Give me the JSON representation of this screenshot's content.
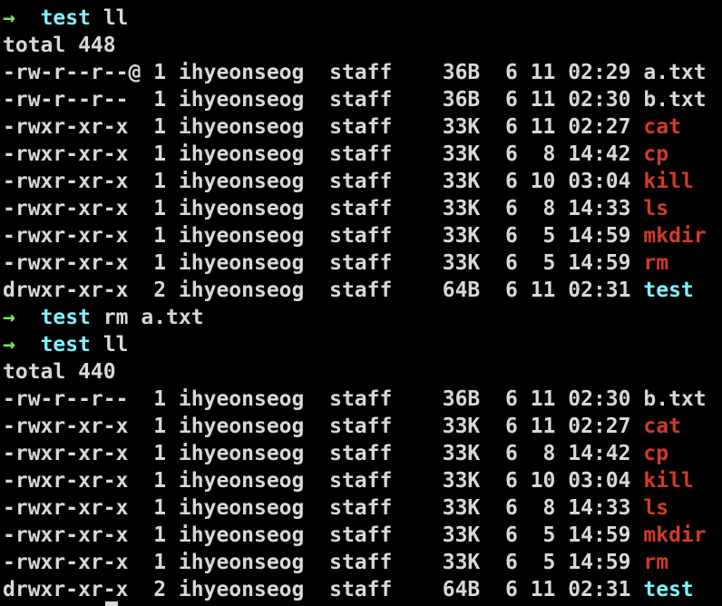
{
  "colors": {
    "background": "#000000",
    "text": "#d8d8d8",
    "prompt_arrow": "#7ee65e",
    "directory": "#7ef2ff",
    "executable": "#d13a26"
  },
  "prompt_symbol": "→",
  "lines": [
    {
      "kind": "prompt",
      "dir": "test",
      "cmd": "ll"
    },
    {
      "kind": "text",
      "text": "total 448"
    },
    {
      "kind": "entry",
      "perms": "-rw-r--r--@",
      "links": "1",
      "owner": "ihyeonseog",
      "group": "staff",
      "size": "36B",
      "month": "6",
      "day": "11",
      "time": "02:29",
      "name": "a.txt",
      "type": "file"
    },
    {
      "kind": "entry",
      "perms": "-rw-r--r--",
      "links": "1",
      "owner": "ihyeonseog",
      "group": "staff",
      "size": "36B",
      "month": "6",
      "day": "11",
      "time": "02:30",
      "name": "b.txt",
      "type": "file"
    },
    {
      "kind": "entry",
      "perms": "-rwxr-xr-x",
      "links": "1",
      "owner": "ihyeonseog",
      "group": "staff",
      "size": "33K",
      "month": "6",
      "day": "11",
      "time": "02:27",
      "name": "cat",
      "type": "exec"
    },
    {
      "kind": "entry",
      "perms": "-rwxr-xr-x",
      "links": "1",
      "owner": "ihyeonseog",
      "group": "staff",
      "size": "33K",
      "month": "6",
      "day": "8",
      "time": "14:42",
      "name": "cp",
      "type": "exec"
    },
    {
      "kind": "entry",
      "perms": "-rwxr-xr-x",
      "links": "1",
      "owner": "ihyeonseog",
      "group": "staff",
      "size": "33K",
      "month": "6",
      "day": "10",
      "time": "03:04",
      "name": "kill",
      "type": "exec"
    },
    {
      "kind": "entry",
      "perms": "-rwxr-xr-x",
      "links": "1",
      "owner": "ihyeonseog",
      "group": "staff",
      "size": "33K",
      "month": "6",
      "day": "8",
      "time": "14:33",
      "name": "ls",
      "type": "exec"
    },
    {
      "kind": "entry",
      "perms": "-rwxr-xr-x",
      "links": "1",
      "owner": "ihyeonseog",
      "group": "staff",
      "size": "33K",
      "month": "6",
      "day": "5",
      "time": "14:59",
      "name": "mkdir",
      "type": "exec"
    },
    {
      "kind": "entry",
      "perms": "-rwxr-xr-x",
      "links": "1",
      "owner": "ihyeonseog",
      "group": "staff",
      "size": "33K",
      "month": "6",
      "day": "5",
      "time": "14:59",
      "name": "rm",
      "type": "exec"
    },
    {
      "kind": "entry",
      "perms": "drwxr-xr-x",
      "links": "2",
      "owner": "ihyeonseog",
      "group": "staff",
      "size": "64B",
      "month": "6",
      "day": "11",
      "time": "02:31",
      "name": "test",
      "type": "dir"
    },
    {
      "kind": "prompt",
      "dir": "test",
      "cmd": "rm a.txt"
    },
    {
      "kind": "prompt",
      "dir": "test",
      "cmd": "ll"
    },
    {
      "kind": "text",
      "text": "total 440"
    },
    {
      "kind": "entry",
      "perms": "-rw-r--r--",
      "links": "1",
      "owner": "ihyeonseog",
      "group": "staff",
      "size": "36B",
      "month": "6",
      "day": "11",
      "time": "02:30",
      "name": "b.txt",
      "type": "file"
    },
    {
      "kind": "entry",
      "perms": "-rwxr-xr-x",
      "links": "1",
      "owner": "ihyeonseog",
      "group": "staff",
      "size": "33K",
      "month": "6",
      "day": "11",
      "time": "02:27",
      "name": "cat",
      "type": "exec"
    },
    {
      "kind": "entry",
      "perms": "-rwxr-xr-x",
      "links": "1",
      "owner": "ihyeonseog",
      "group": "staff",
      "size": "33K",
      "month": "6",
      "day": "8",
      "time": "14:42",
      "name": "cp",
      "type": "exec"
    },
    {
      "kind": "entry",
      "perms": "-rwxr-xr-x",
      "links": "1",
      "owner": "ihyeonseog",
      "group": "staff",
      "size": "33K",
      "month": "6",
      "day": "10",
      "time": "03:04",
      "name": "kill",
      "type": "exec"
    },
    {
      "kind": "entry",
      "perms": "-rwxr-xr-x",
      "links": "1",
      "owner": "ihyeonseog",
      "group": "staff",
      "size": "33K",
      "month": "6",
      "day": "8",
      "time": "14:33",
      "name": "ls",
      "type": "exec"
    },
    {
      "kind": "entry",
      "perms": "-rwxr-xr-x",
      "links": "1",
      "owner": "ihyeonseog",
      "group": "staff",
      "size": "33K",
      "month": "6",
      "day": "5",
      "time": "14:59",
      "name": "mkdir",
      "type": "exec"
    },
    {
      "kind": "entry",
      "perms": "-rwxr-xr-x",
      "links": "1",
      "owner": "ihyeonseog",
      "group": "staff",
      "size": "33K",
      "month": "6",
      "day": "5",
      "time": "14:59",
      "name": "rm",
      "type": "exec"
    },
    {
      "kind": "entry",
      "perms": "drwxr-xr-x",
      "links": "2",
      "owner": "ihyeonseog",
      "group": "staff",
      "size": "64B",
      "month": "6",
      "day": "11",
      "time": "02:31",
      "name": "test",
      "type": "dir"
    }
  ]
}
